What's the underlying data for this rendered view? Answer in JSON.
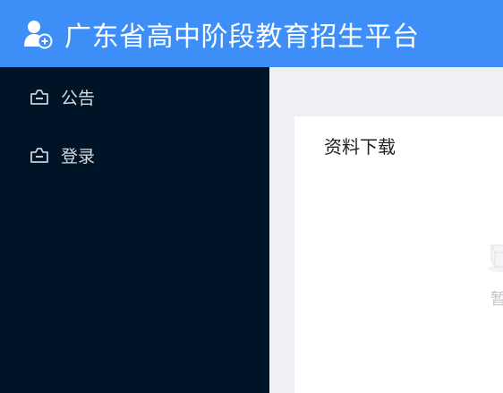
{
  "header": {
    "title": "广东省高中阶段教育招生平台",
    "logo_icon": "user-add-icon"
  },
  "sidebar": {
    "items": [
      {
        "label": "公告",
        "icon": "folder-icon"
      },
      {
        "label": "登录",
        "icon": "folder-icon"
      }
    ]
  },
  "main": {
    "card_title": "资料下载",
    "empty_text": "暂"
  },
  "colors": {
    "header_bg": "#3d8ff7",
    "sidebar_bg": "#001428",
    "main_bg": "#eef0f3",
    "card_bg": "#ffffff"
  }
}
